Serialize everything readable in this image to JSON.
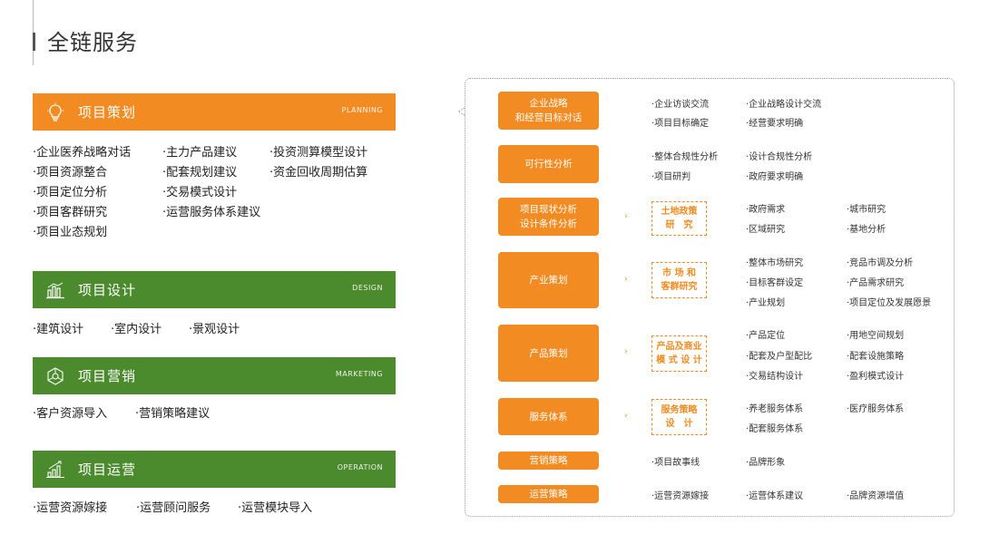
{
  "page": {
    "title": "全链服务"
  },
  "left": {
    "planning": {
      "name": "项目策划",
      "en": "PLANNING",
      "icon": "lightbulb-icon",
      "items": [
        [
          "·企业医养战略对话",
          "·主力产品建议",
          "·投资测算模型设计"
        ],
        [
          "·项目资源整合",
          "·配套规划建议",
          "·资金回收周期估算"
        ],
        [
          "·项目定位分析",
          "·交易模式设计",
          ""
        ],
        [
          "·项目客群研究",
          "·运营服务体系建议",
          ""
        ],
        [
          "·项目业态规划",
          "",
          ""
        ]
      ]
    },
    "design": {
      "name": "项目设计",
      "en": "DESIGN",
      "icon": "bar-chart-icon",
      "items": [
        [
          "·建筑设计",
          "·室内设计",
          "·景观设计"
        ]
      ]
    },
    "marketing": {
      "name": "项目营销",
      "en": "MARKETING",
      "icon": "network-icon",
      "items": [
        [
          "·客户资源导入",
          "·营销策略建议"
        ]
      ]
    },
    "operation": {
      "name": "项目运营",
      "en": "OPERATION",
      "icon": "growth-chart-icon",
      "items": [
        [
          "·运营资源嫁接",
          "·运营顾问服务",
          "·运营模块导入"
        ]
      ]
    }
  },
  "right": {
    "rows": [
      {
        "label": [
          "企业战略",
          "和经营目标对话"
        ],
        "sub": null,
        "items": [
          [
            "·企业访谈交流",
            "·企业战略设计交流"
          ],
          [
            "·项目目标确定",
            "·经营要求明确"
          ]
        ]
      },
      {
        "label": [
          "可行性分析"
        ],
        "sub": null,
        "items": [
          [
            "·整体合规性分析",
            "·设计合规性分析"
          ],
          [
            "·项目研判",
            "·政府要求明确"
          ]
        ]
      },
      {
        "label": [
          "项目现状分析",
          "设计条件分析"
        ],
        "sub": [
          "土地政策",
          "研　究"
        ],
        "arrow": "›",
        "items": [
          [
            "·政府需求",
            "·城市研究"
          ],
          [
            "·区域研究",
            "·基地分析"
          ]
        ]
      },
      {
        "label": [
          "产业策划"
        ],
        "sub": [
          "市 场 和",
          "客群研究"
        ],
        "arrow": "›",
        "items": [
          [
            "·整体市场研究",
            "·竞品市调及分析"
          ],
          [
            "·目标客群设定",
            "·产品需求研究"
          ],
          [
            "·产业规划",
            "·项目定位及发展愿景"
          ]
        ]
      },
      {
        "label": [
          "产品策划"
        ],
        "sub": [
          "产品及商业",
          "模 式 设 计"
        ],
        "arrow": "›",
        "items": [
          [
            "·产品定位",
            "·用地空间规划"
          ],
          [
            "·配套及户型配比",
            "·配套设施策略"
          ],
          [
            "·交易结构设计",
            "·盈利模式设计"
          ]
        ]
      },
      {
        "label": [
          "服务体系"
        ],
        "sub": [
          "服务策略",
          "设　计"
        ],
        "arrow": "›",
        "items": [
          [
            "·养老服务体系",
            "·医疗服务体系"
          ],
          [
            "·配套服务体系",
            ""
          ]
        ]
      },
      {
        "label": [
          "营销策略"
        ],
        "sub": null,
        "items": [
          [
            "·项目故事线",
            "·品牌形象"
          ]
        ]
      },
      {
        "label": [
          "运营策略"
        ],
        "sub": null,
        "items": [
          [
            "·运营资源嫁接",
            "·运营体系建议",
            "·品牌资源增值"
          ]
        ]
      }
    ]
  },
  "colors": {
    "orange": "#f28b21",
    "green": "#4b8b2d"
  }
}
